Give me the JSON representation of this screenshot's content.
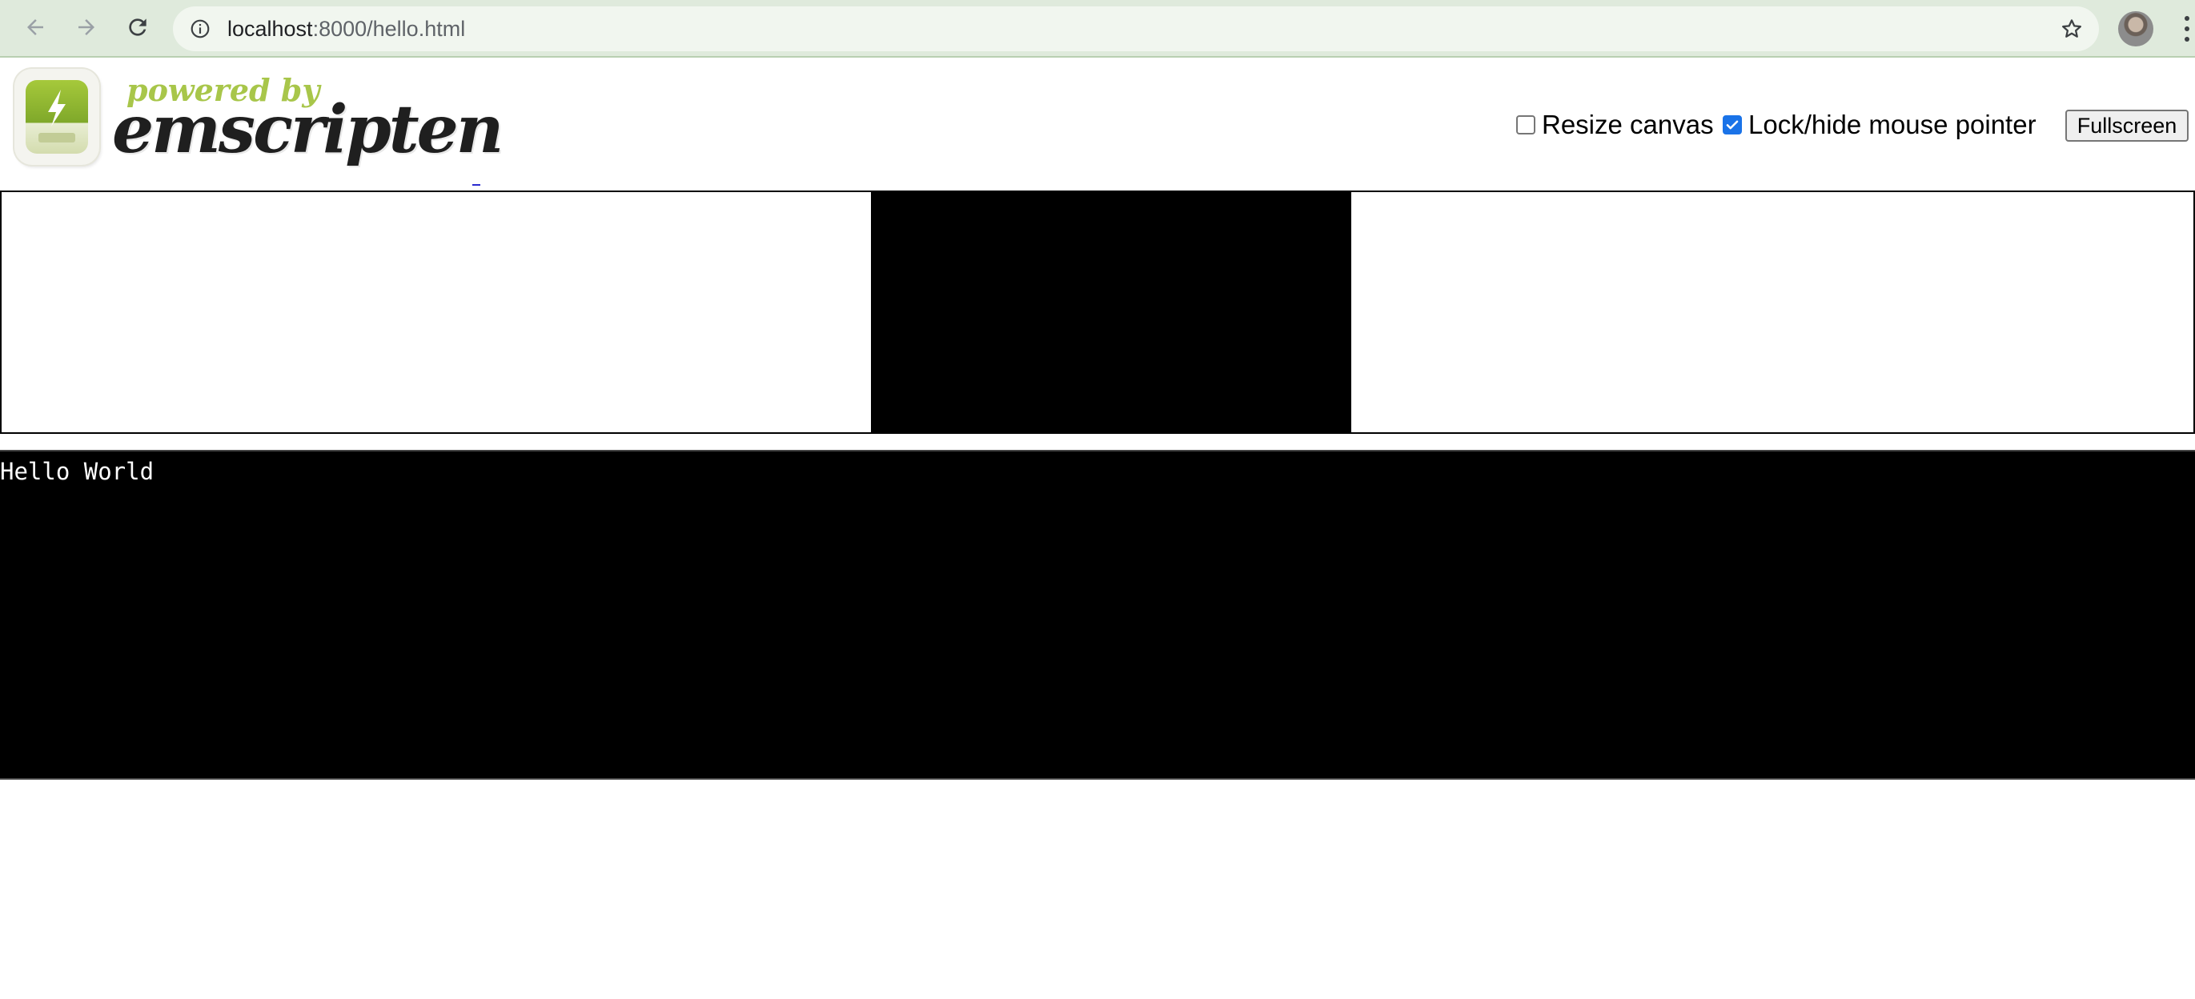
{
  "browser": {
    "url_host": "localhost",
    "url_rest": ":8000/hello.html"
  },
  "header": {
    "logo_small": "powered by",
    "logo_big": "emscripten",
    "resize_canvas_label": "Resize canvas",
    "resize_canvas_checked": false,
    "lock_pointer_label": "Lock/hide mouse pointer",
    "lock_pointer_checked": true,
    "fullscreen_label": "Fullscreen"
  },
  "output": {
    "text": "Hello World"
  },
  "colors": {
    "brand_green": "#a8c64a",
    "checkbox_blue": "#1a73e8",
    "chrome_tint": "#dfeadc"
  }
}
